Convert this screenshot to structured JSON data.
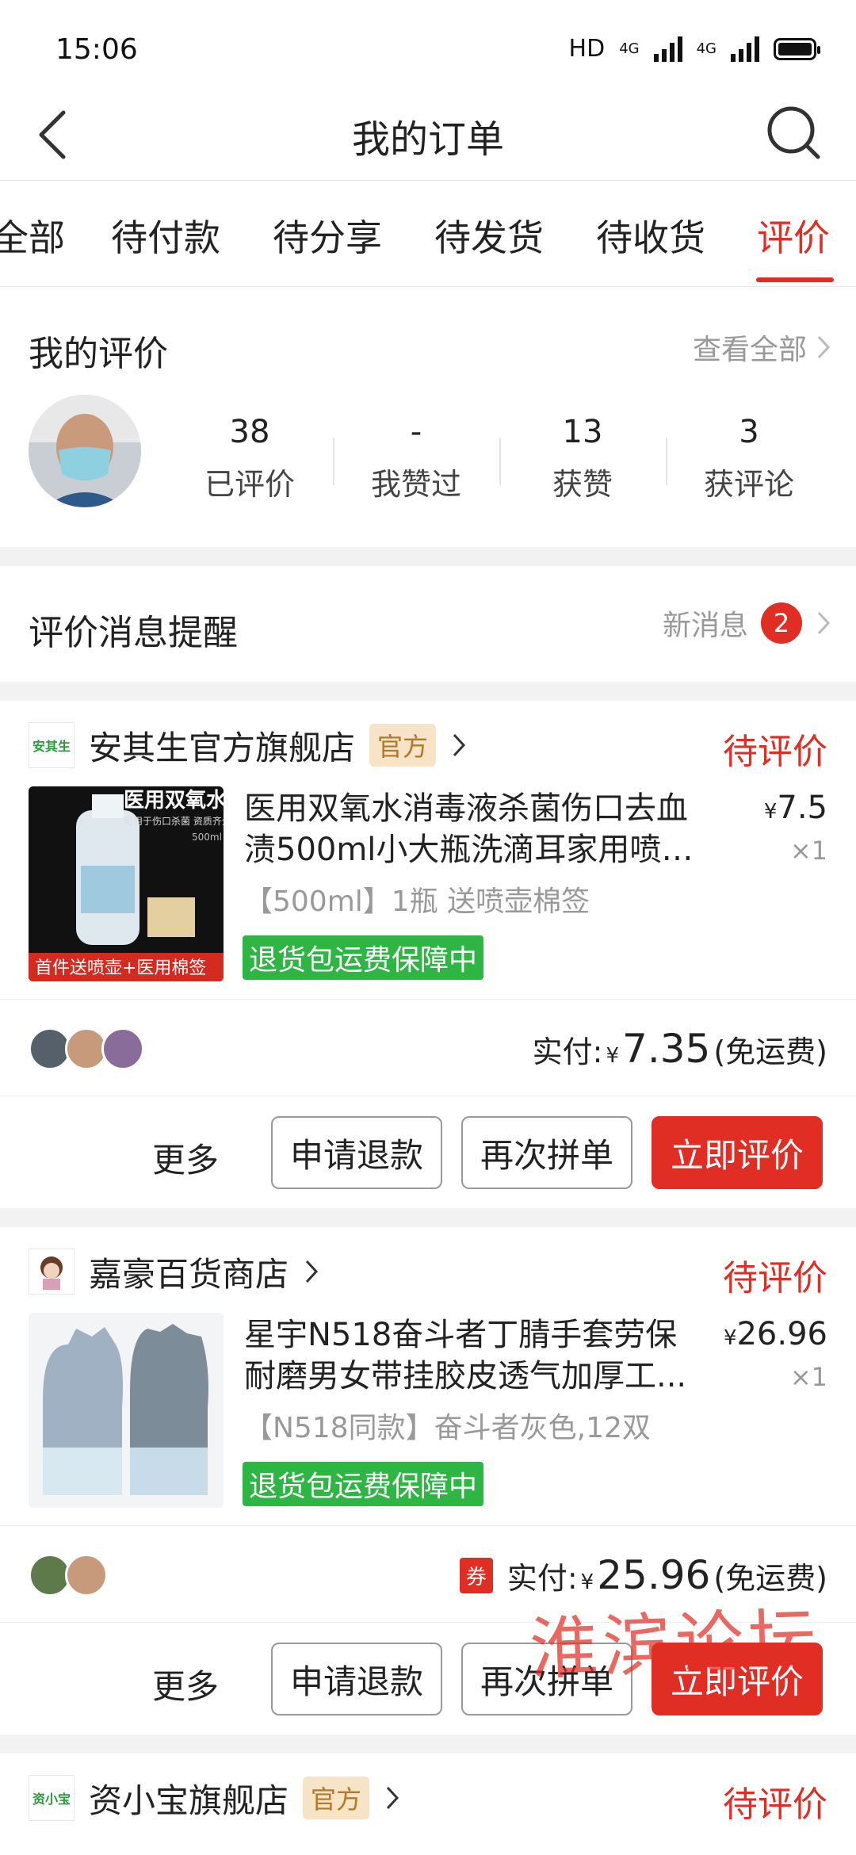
{
  "status_bar": {
    "time": "15:06",
    "hd_label": "HD",
    "net1": "4G",
    "net2": "4G"
  },
  "header": {
    "title": "我的订单"
  },
  "tabs": [
    {
      "label": "全部"
    },
    {
      "label": "待付款"
    },
    {
      "label": "待分享"
    },
    {
      "label": "待发货"
    },
    {
      "label": "待收货"
    },
    {
      "label": "评价",
      "active": true
    }
  ],
  "my_reviews": {
    "label": "我的评价",
    "view_all": "查看全部",
    "stats": [
      {
        "num": "38",
        "label": "已评价"
      },
      {
        "num": "-",
        "label": "我赞过"
      },
      {
        "num": "13",
        "label": "获赞"
      },
      {
        "num": "3",
        "label": "获评论"
      }
    ]
  },
  "notifications": {
    "label": "评价消息提醒",
    "new_text": "新消息",
    "count": "2"
  },
  "orders": [
    {
      "shop_logo_text": "安其生",
      "shop_name": "安其生官方旗舰店",
      "official": "官方",
      "status": "待评价",
      "img_text_top": "医用双氧水",
      "img_text_sub": "可用于伤口杀菌 资质齐全",
      "img_text_vol": "500ml",
      "img_text_bottom": "首件送喷壶+医用棉签",
      "title_line1": "医用双氧水消毒液杀菌伤口去血",
      "title_line2": "渍500ml小大瓶洗滴耳家用喷雾...",
      "price_symbol": "¥",
      "price": "7.5",
      "qty": "×1",
      "spec": "【500ml】1瓶 送喷壶棉签",
      "guarantee": "退货包运费保障中",
      "paid_label": "实付:",
      "paid_symbol": "¥",
      "paid_amount": "7.35",
      "shipping": "(免运费)",
      "more": "更多",
      "btn_refund": "申请退款",
      "btn_again": "再次拼单",
      "btn_review": "立即评价"
    },
    {
      "shop_name": "嘉豪百货商店",
      "status": "待评价",
      "title_line1": "星宇N518奋斗者丁腈手套劳保",
      "title_line2": "耐磨男女带挂胶皮透气加厚工...",
      "price_symbol": "¥",
      "price": "26.96",
      "qty": "×1",
      "spec": "【N518同款】奋斗者灰色,12双",
      "guarantee": "退货包运费保障中",
      "coupon": "券",
      "paid_label": "实付:",
      "paid_symbol": "¥",
      "paid_amount": "25.96",
      "shipping": "(免运费)",
      "more": "更多",
      "btn_refund": "申请退款",
      "btn_again": "再次拼单",
      "btn_review": "立即评价"
    },
    {
      "shop_logo_text": "资小宝",
      "shop_name": "资小宝旗舰店",
      "official": "官方",
      "status": "待评价"
    }
  ],
  "watermark": "淮滨论坛",
  "colors": {
    "accent": "#e02e24",
    "guarantee": "#2fb543",
    "official_bg": "#f7e3c5"
  }
}
